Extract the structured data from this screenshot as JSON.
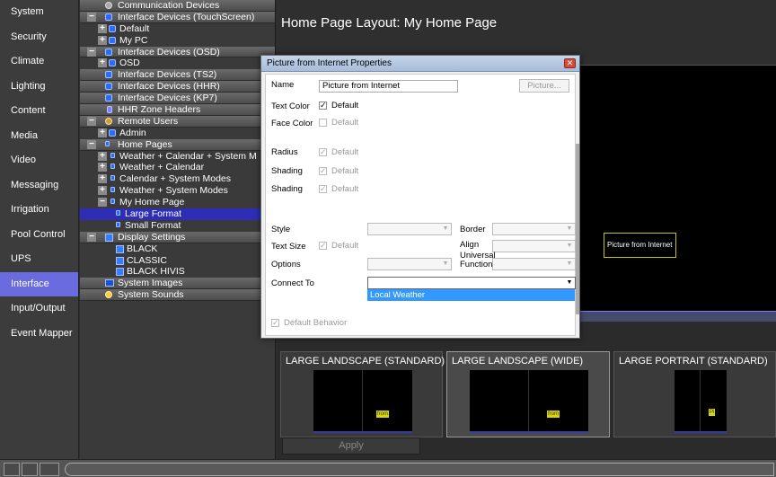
{
  "nav": {
    "items": [
      "System",
      "Security",
      "Climate",
      "Lighting",
      "Content",
      "Media",
      "Video",
      "Messaging",
      "Irrigation",
      "Pool Control",
      "UPS",
      "Interface",
      "Input/Output",
      "Event Mapper"
    ],
    "active": "Interface",
    "active_color": "#6b6be0"
  },
  "tree": {
    "rows": [
      {
        "label": "Communication Devices",
        "icon": "gear-icon"
      },
      {
        "label": "Interface Devices (TouchScreen)",
        "icon": "device-icon"
      },
      {
        "label": "Default",
        "icon": "device-icon"
      },
      {
        "label": "My PC",
        "icon": "device-icon"
      },
      {
        "label": "Interface Devices (OSD)",
        "icon": "device-icon"
      },
      {
        "label": "OSD",
        "icon": "device-icon"
      },
      {
        "label": "Interface Devices (TS2)",
        "icon": "device-icon"
      },
      {
        "label": "Interface Devices (HHR)",
        "icon": "device-icon"
      },
      {
        "label": "Interface Devices (KP7)",
        "icon": "device-icon"
      },
      {
        "label": "HHR Zone Headers",
        "icon": "hhr-icon"
      },
      {
        "label": "Remote Users",
        "icon": "users-icon"
      },
      {
        "label": "Admin",
        "icon": "device-icon"
      },
      {
        "label": "Home Pages",
        "icon": "page-icon"
      },
      {
        "label": "Weather + Calendar + System M",
        "icon": "page-icon"
      },
      {
        "label": "Weather + Calendar",
        "icon": "page-icon"
      },
      {
        "label": "Calendar + System Modes",
        "icon": "page-icon"
      },
      {
        "label": "Weather + System Modes",
        "icon": "page-icon"
      },
      {
        "label": "My Home Page",
        "icon": "page-icon"
      },
      {
        "label": "Large Format",
        "icon": "page-icon"
      },
      {
        "label": "Small Format",
        "icon": "page-icon"
      },
      {
        "label": "Display Settings",
        "icon": "stack-icon"
      },
      {
        "label": "BLACK",
        "icon": "stack-icon"
      },
      {
        "label": "CLASSIC",
        "icon": "stack-icon"
      },
      {
        "label": "BLACK HIVIS",
        "icon": "stack-icon"
      },
      {
        "label": "System Images",
        "icon": "image-icon"
      },
      {
        "label": "System Sounds",
        "icon": "sound-icon"
      }
    ],
    "selected": "Large Format"
  },
  "main": {
    "title": "Home Page Layout: My Home Page",
    "widget_label": "Picture from Internet",
    "widget_border_color": "#c8c800",
    "layouts": [
      {
        "title": "LARGE LANDSCAPE (STANDARD)",
        "tag": "from"
      },
      {
        "title": "LARGE LANDSCAPE (WIDE)",
        "tag": "from"
      },
      {
        "title": "LARGE PORTRAIT (STANDARD)",
        "tag": "Pi"
      }
    ],
    "selected_layout": "LARGE LANDSCAPE (WIDE)",
    "apply_label": "Apply"
  },
  "dialog": {
    "title": "Picture from Internet Properties",
    "close_glyph": "✕",
    "name_label": "Name",
    "name_value": "Picture from Internet",
    "picture_button": "Picture...",
    "text_color_label": "Text Color",
    "face_color_label": "Face Color",
    "radius_label": "Radius",
    "shading_label_1": "Shading",
    "shading_label_2": "Shading",
    "default_label": "Default",
    "style_label": "Style",
    "border_label": "Border",
    "text_size_label": "Text Size",
    "align_label": "Align",
    "options_label": "Options",
    "universal_function_label": "Universal Function",
    "connect_to_label": "Connect To",
    "connect_to_option": "Local Weather",
    "default_behavior_label": "Default Behavior",
    "check_glyph": "✓",
    "arrow_glyph": "▼",
    "highlight_color": "#3399ff"
  }
}
